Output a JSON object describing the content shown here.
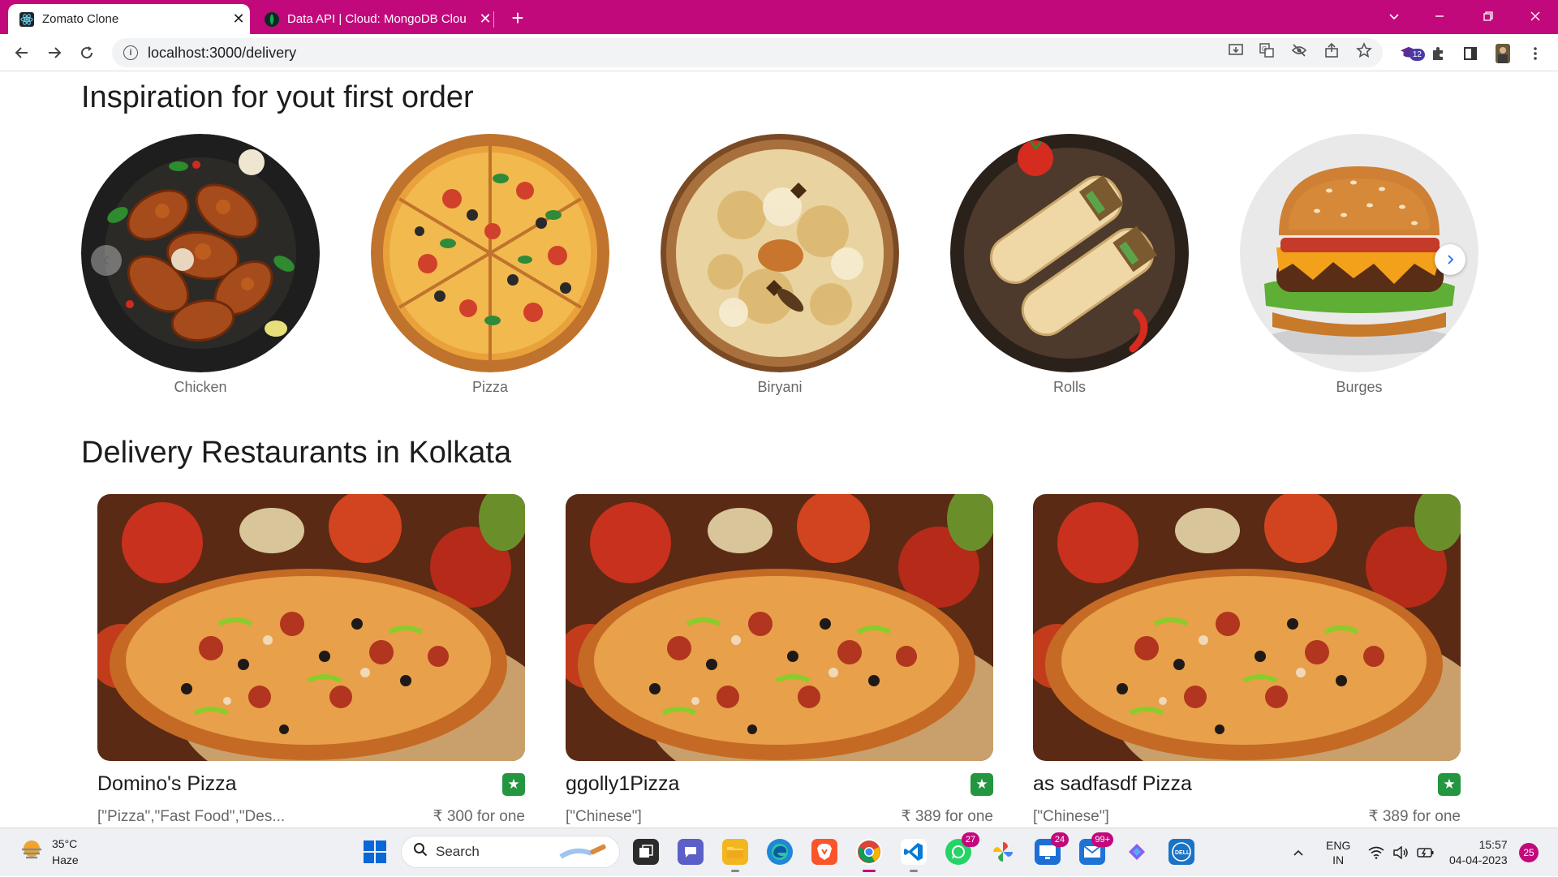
{
  "browser": {
    "tabs": [
      {
        "title": "Zomato Clone",
        "active": true,
        "icon": "react-icon"
      },
      {
        "title": "Data API | Cloud: MongoDB Clou",
        "active": false,
        "icon": "mongodb-leaf-icon"
      }
    ],
    "new_tab": "+",
    "url": "localhost:3000/delivery",
    "accent_color": "#c2097c",
    "extension_badge": "12"
  },
  "page": {
    "inspiration_title": "Inspiration for yout first order",
    "categories": [
      {
        "label": "Chicken"
      },
      {
        "label": "Pizza"
      },
      {
        "label": "Biryani"
      },
      {
        "label": "Rolls"
      },
      {
        "label": "Burges"
      }
    ],
    "delivery_title": "Delivery Restaurants in Kolkata",
    "restaurants": [
      {
        "name": "Domino's Pizza",
        "cuisines": "[\"Pizza\",\"Fast Food\",\"Des...",
        "price": "₹ 300 for one"
      },
      {
        "name": "ggolly1Pizza",
        "cuisines": "[\"Chinese\"]",
        "price": "₹ 389 for one"
      },
      {
        "name": "as sadfasdf Pizza",
        "cuisines": "[\"Chinese\"]",
        "price": "₹ 389 for one"
      }
    ],
    "rating_color": "#24963f"
  },
  "taskbar": {
    "weather_temp": "35°C",
    "weather_desc": "Haze",
    "search_label": "Search",
    "badges": {
      "whatsapp": "27",
      "teams": "24",
      "mail": "99+"
    },
    "language": "ENG",
    "region": "IN",
    "time": "15:57",
    "date": "04-04-2023",
    "notification_count": "25"
  }
}
